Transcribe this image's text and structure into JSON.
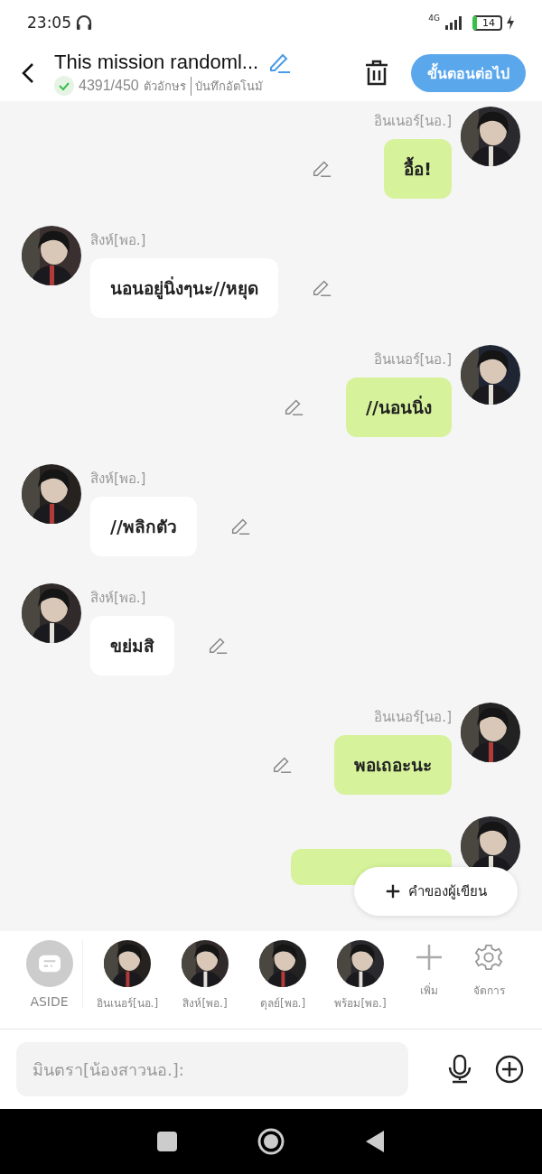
{
  "status_bar": {
    "time": "23:05",
    "network": "4G",
    "battery": "14"
  },
  "header": {
    "title": "This mission randoml...",
    "count": "4391/450",
    "count_unit": "ตัวอักษร",
    "autosave": "บันทึกอัตโนมั",
    "next_button": "ขั้นตอนต่อไป"
  },
  "messages": [
    {
      "kind": "right",
      "sender": "อินเนอร์[นอ.]",
      "text": "อื้อ!"
    },
    {
      "kind": "left",
      "sender": "สิงห์[พอ.]",
      "text": "นอนอยู่นิ่งๆนะ//หยุด"
    },
    {
      "kind": "right",
      "sender": "อินเนอร์[นอ.]",
      "text": "//นอนนิ่ง"
    },
    {
      "kind": "left",
      "sender": "สิงห์[พอ.]",
      "text": "//พลิกตัว"
    },
    {
      "kind": "left",
      "sender": "สิงห์[พอ.]",
      "text": "ขย่มสิ"
    },
    {
      "kind": "right",
      "sender": "อินเนอร์[นอ.]",
      "text": "พอเถอะนะ"
    },
    {
      "kind": "right_partial"
    }
  ],
  "floating_button": "คำของผู้เขียน",
  "characters": [
    {
      "kind": "aside",
      "name": "ASIDE"
    },
    {
      "kind": "character",
      "name": "อินเนอร์[นอ.]"
    },
    {
      "kind": "character",
      "name": "สิงห์[พอ.]"
    },
    {
      "kind": "character",
      "name": "ดุลย์[พอ.]"
    },
    {
      "kind": "character",
      "name": "พร้อม[พอ.]"
    },
    {
      "kind": "add",
      "name": "เพิ่ม"
    },
    {
      "kind": "manage",
      "name": "จัดการ"
    }
  ],
  "input": {
    "placeholder": "มินตรา[น้องสาวนอ.]:"
  }
}
